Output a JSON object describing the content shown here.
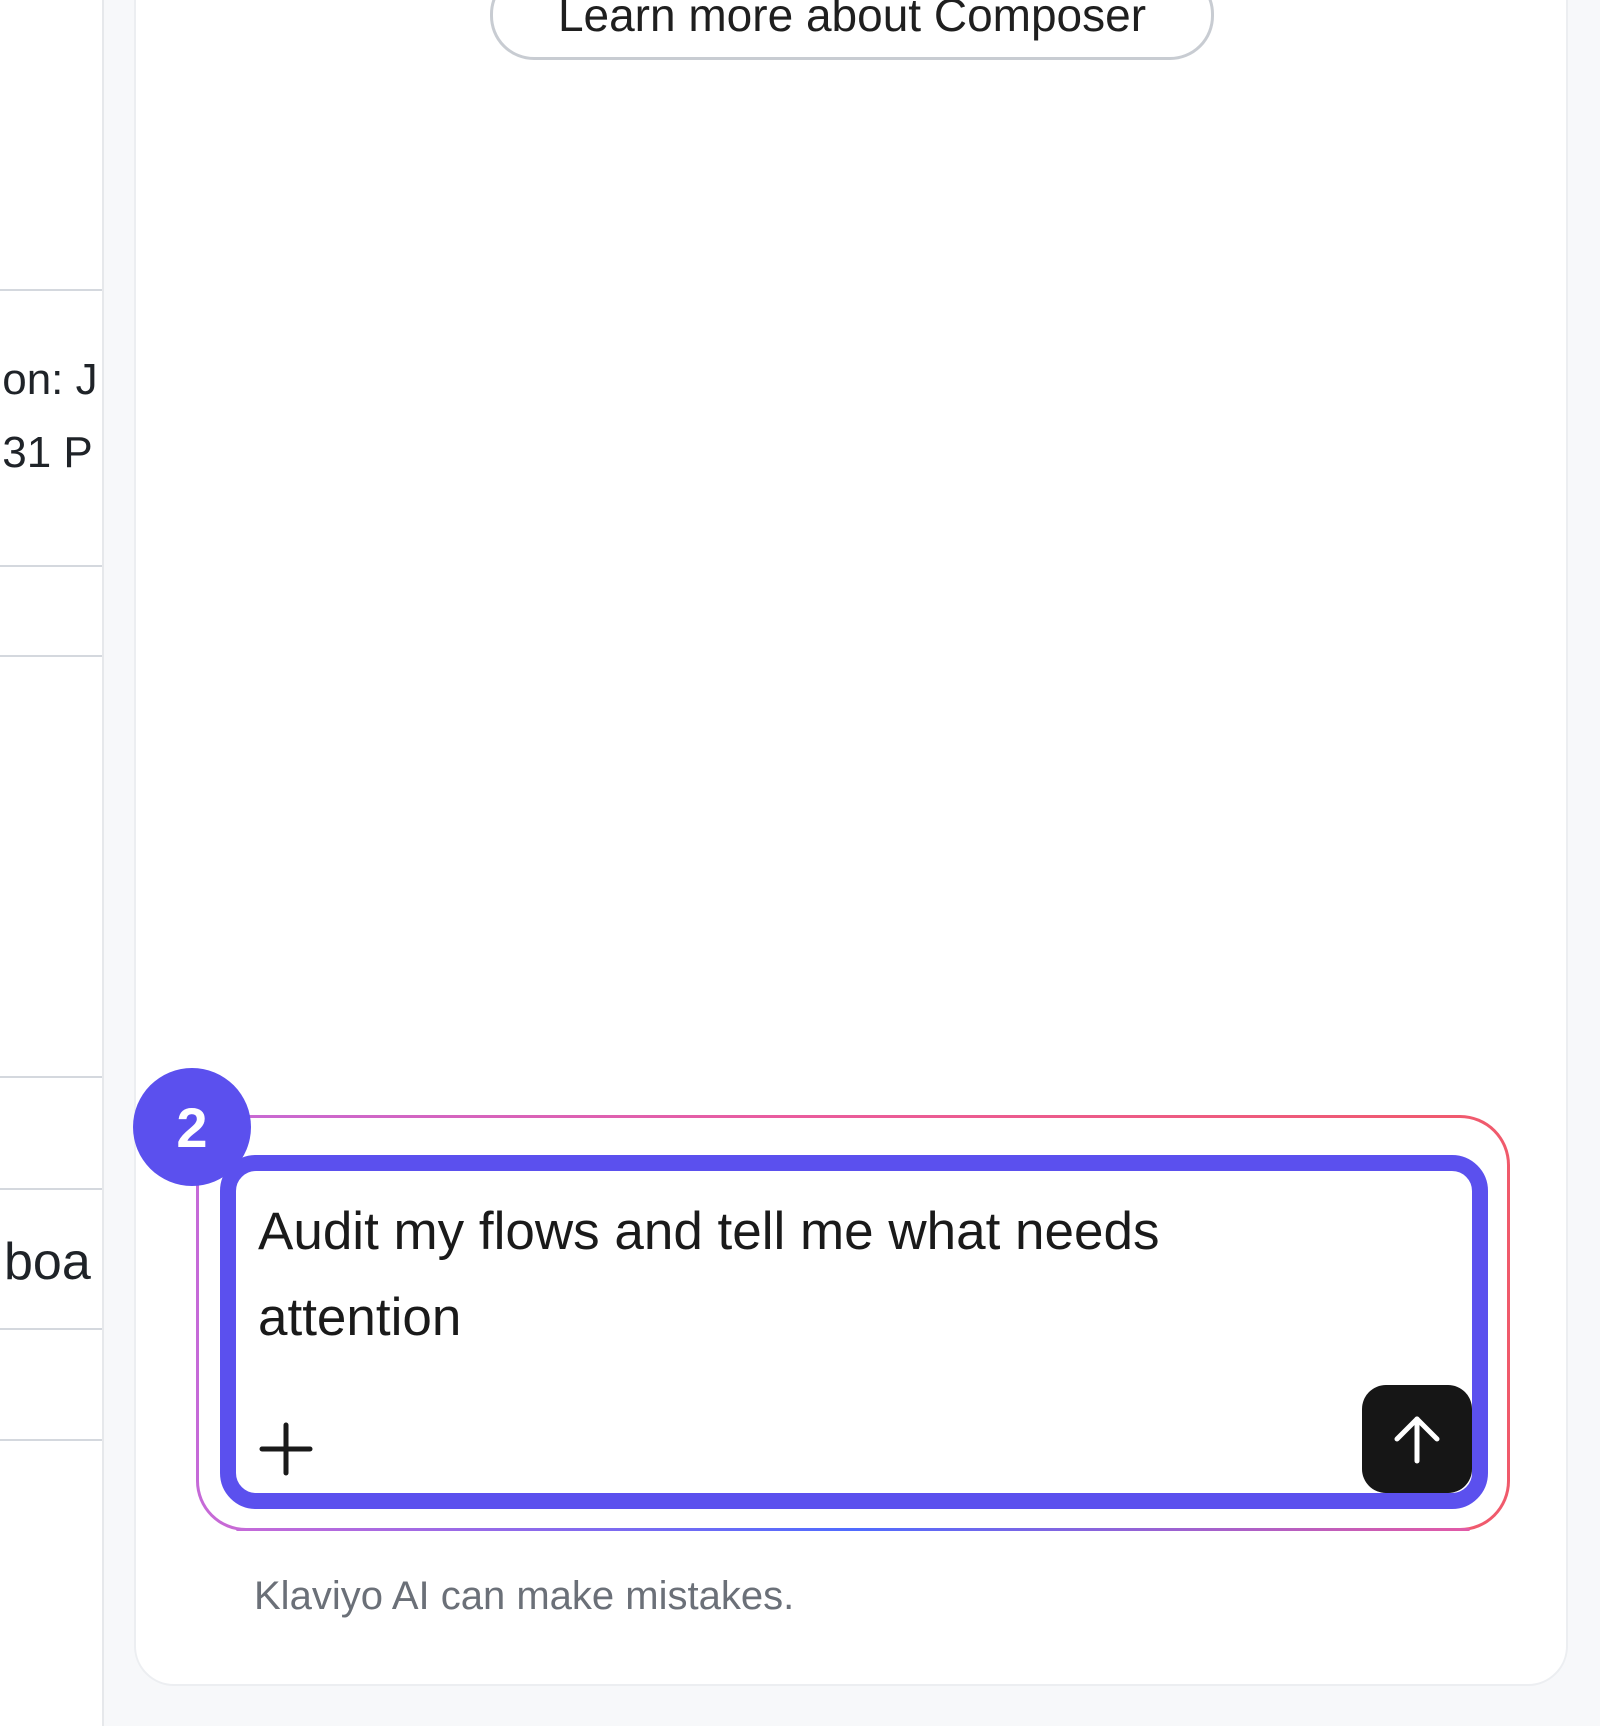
{
  "background_page": {
    "fragments": [
      ":on: J",
      ":31 P",
      "boa"
    ]
  },
  "composer": {
    "learn_more_label": "Learn more about Composer",
    "prompt": {
      "value": "Audit my flows and tell me what needs attention",
      "add_icon": "plus-icon",
      "send_icon": "arrow-up-icon"
    },
    "step_badge": "2",
    "disclaimer": "Klaviyo AI can make mistakes."
  },
  "colors": {
    "accent": "#5b50ee",
    "send_button": "#161616",
    "gradient_start": "#c56ad8",
    "gradient_mid": "#ea5c9e",
    "gradient_end": "#f05a6b",
    "disclaimer_text": "#6b7078"
  }
}
